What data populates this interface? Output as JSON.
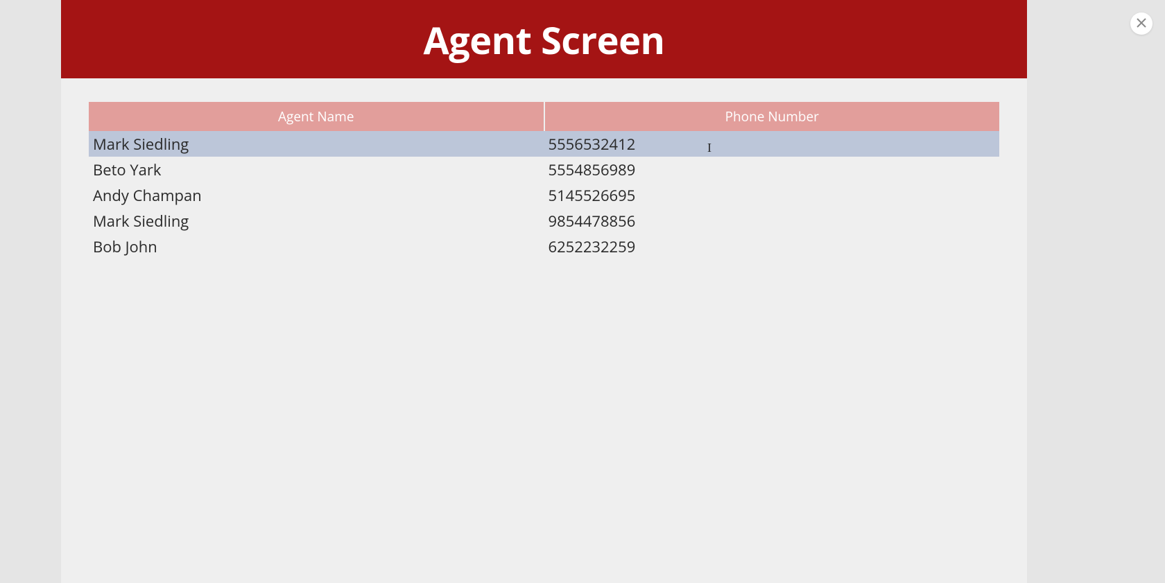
{
  "header": {
    "title": "Agent Screen"
  },
  "table": {
    "columns": [
      {
        "label": "Agent Name"
      },
      {
        "label": "Phone Number"
      }
    ],
    "rows": [
      {
        "name": "Mark Siedling",
        "phone": "5556532412",
        "selected": true
      },
      {
        "name": "Beto Yark",
        "phone": "5554856989",
        "selected": false
      },
      {
        "name": "Andy Champan",
        "phone": "5145526695",
        "selected": false
      },
      {
        "name": "Mark Siedling",
        "phone": "9854478856",
        "selected": false
      },
      {
        "name": "Bob John",
        "phone": "6252232259",
        "selected": false
      }
    ]
  },
  "close_label": "Close",
  "cursor_glyph": "I"
}
